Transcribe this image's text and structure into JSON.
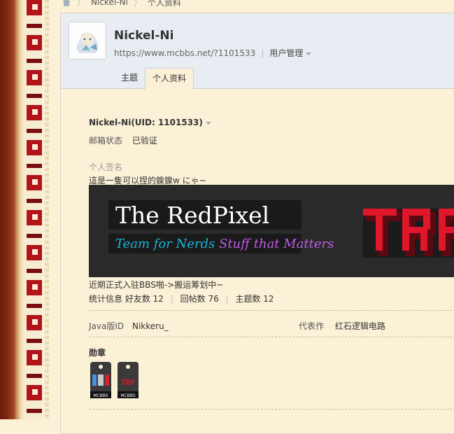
{
  "breadcrumb": [
    "Nickel-Ni",
    "个人资料"
  ],
  "user": {
    "name": "Nickel-Ni",
    "url": "https://www.mcbbs.net/?1101533",
    "manage_label": "用户管理"
  },
  "tabs": [
    "主题",
    "个人资料"
  ],
  "profile": {
    "uid_line": "Nickel-Ni(UID: 1101533)",
    "email_label": "邮箱状态",
    "email_value": "已验证",
    "signature_label": "个人签名",
    "signature_text": "這是一隻可以捏的鎳鎳w にゃ~",
    "banner_title": "The RedPixel",
    "banner_sub_1": "Team for Nerds",
    "banner_sub_2": "Stuff that Matters",
    "banner_logo": "TRP",
    "note": "近期正式入驻BBS啪->搬运筹划中~",
    "stats_label": "统计信息",
    "friends": "好友数 12",
    "replies": "回帖数 76",
    "threads": "主题数 12",
    "java_label": "Java版ID",
    "java_value": "Nikkeru_",
    "work_label": "代表作",
    "work_value": "红石逻辑电路",
    "medals_label": "勋章",
    "medal_caption": "MCBBS"
  },
  "colors": {
    "page_bg": "#fbf1d7",
    "header_bg": "#e8edf3",
    "banner_bg": "#2a2a2a",
    "trp_red": "#e0162b",
    "accent_cyan": "#19b8d8",
    "accent_purple": "#c25be8"
  }
}
